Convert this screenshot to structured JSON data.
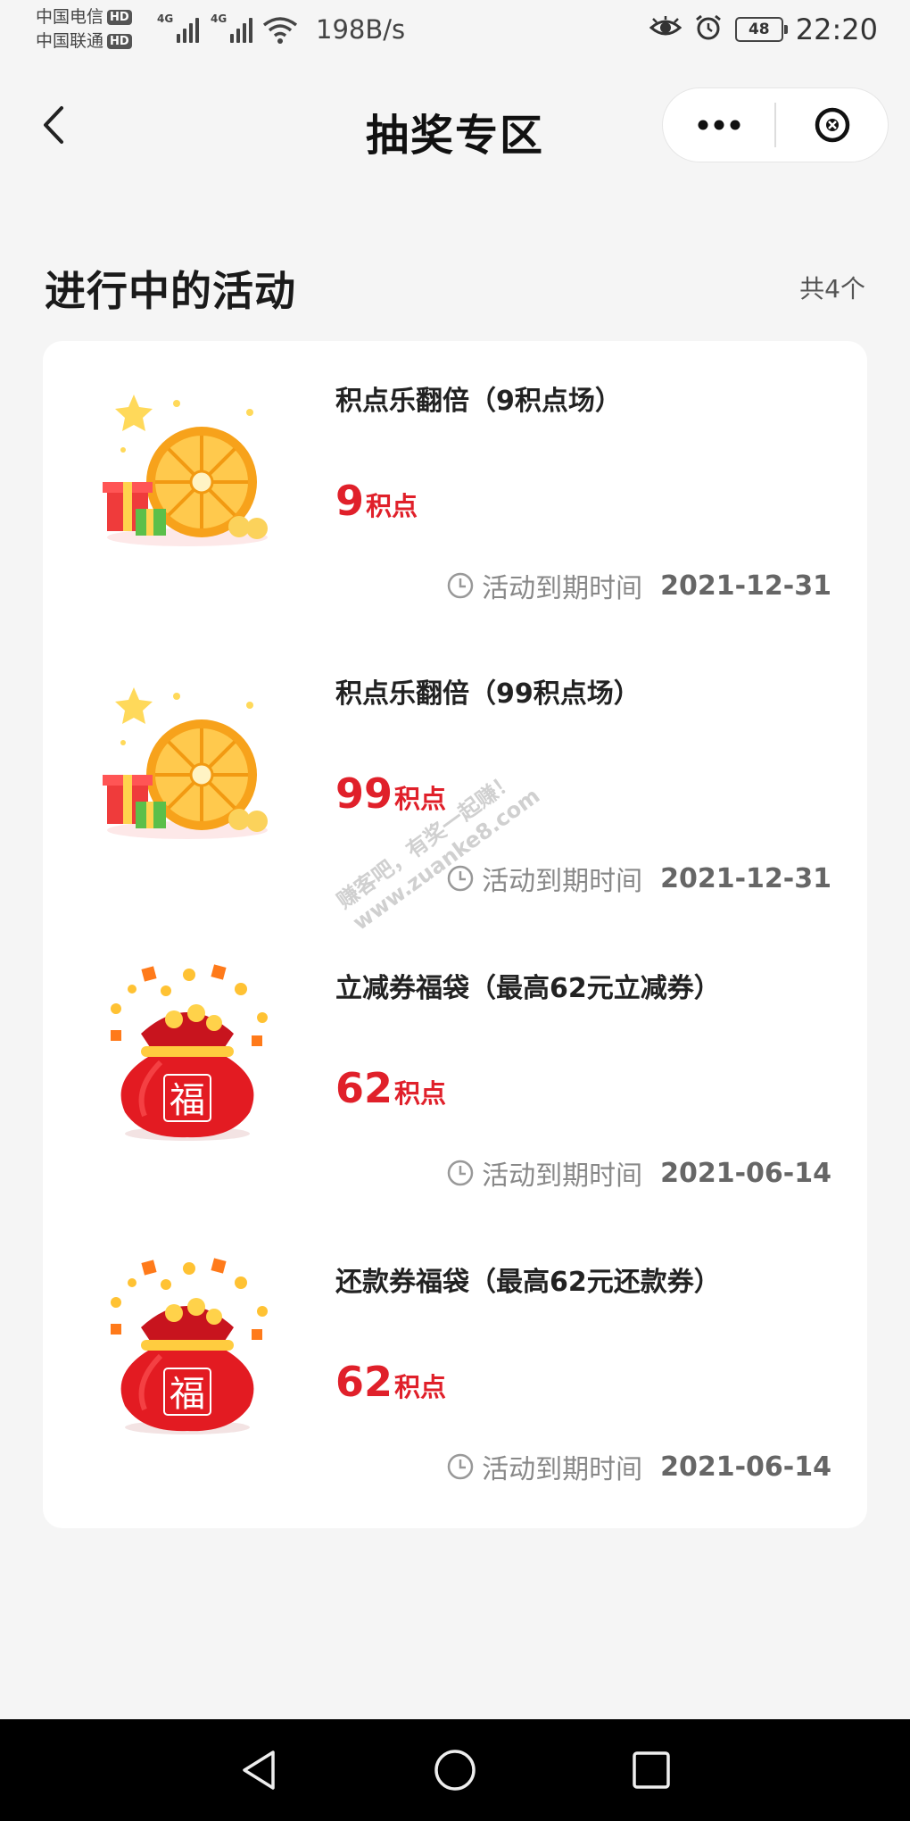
{
  "status_bar": {
    "carrier1": "中国电信",
    "carrier2": "中国联通",
    "hd_badge": "HD",
    "network_type": "4G",
    "net_speed": "198B/s",
    "battery": "48",
    "time": "22:20"
  },
  "nav": {
    "title": "抽奖专区",
    "back_icon": "chevron-left-icon",
    "more_icon": "more-dots-icon",
    "close_icon": "close-circle-icon"
  },
  "section": {
    "title": "进行中的活动",
    "count": "共4个"
  },
  "activities": [
    {
      "name": "积点乐翻倍（9积点场）",
      "points": "9",
      "unit": "积点",
      "expiry_label": "活动到期时间",
      "expiry_date": "2021-12-31",
      "icon": "prize-wheel-icon"
    },
    {
      "name": "积点乐翻倍（99积点场）",
      "points": "99",
      "unit": "积点",
      "expiry_label": "活动到期时间",
      "expiry_date": "2021-12-31",
      "icon": "prize-wheel-icon"
    },
    {
      "name": "立减券福袋（最高62元立减券）",
      "points": "62",
      "unit": "积点",
      "expiry_label": "活动到期时间",
      "expiry_date": "2021-06-14",
      "icon": "lucky-bag-icon",
      "bag_char": "福"
    },
    {
      "name": "还款券福袋（最高62元还款券）",
      "points": "62",
      "unit": "积点",
      "expiry_label": "活动到期时间",
      "expiry_date": "2021-06-14",
      "icon": "lucky-bag-icon",
      "bag_char": "福"
    }
  ],
  "watermark": {
    "line1": "赚客吧，有奖一起赚！",
    "line2": "www.zuanke8.com"
  },
  "colors": {
    "accent_red": "#e0202a",
    "background": "#f5f5f5",
    "card": "#ffffff"
  }
}
